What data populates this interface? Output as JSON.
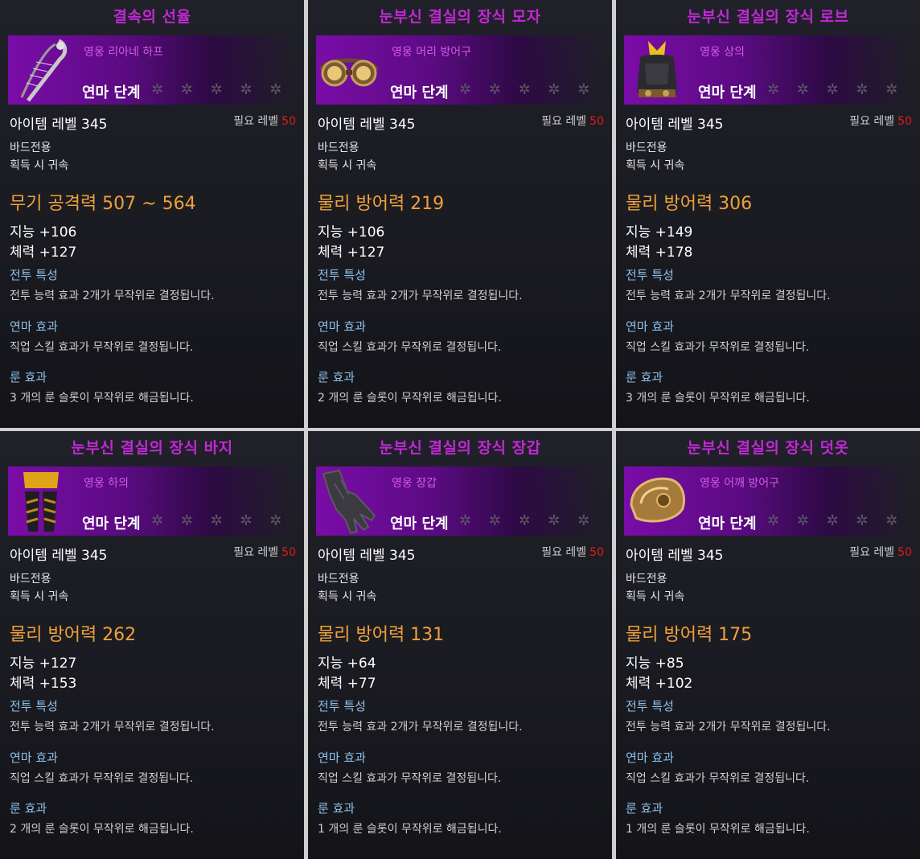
{
  "common": {
    "stage_label": "연마 단계",
    "stars": "✲ ✲ ✲ ✲ ✲",
    "item_level": "아이템 레벨 345",
    "req_label": "필요 레벨",
    "req_value": "50",
    "class_only": "바드전용",
    "bind": "획득 시 귀속",
    "combat_header": "전투 특성",
    "combat_desc": "전투 능력 효과 2개가 무작위로 결정됩니다.",
    "refine_header": "연마 효과",
    "refine_desc": "직업 스킬 효과가 무작위로 결정됩니다.",
    "rune_header": "룬 효과"
  },
  "colors": {
    "title": "#c327d6",
    "grade": "#d557e8",
    "main_stat": "#f0a03a",
    "section_header": "#8fc2ec",
    "required_level": "#e31a1a"
  },
  "cards": [
    {
      "title": "결속의 선율",
      "grade": "영웅 리아네 하프",
      "icon": "harp-icon",
      "main_stat": "무기 공격력 507 ~ 564",
      "stat1": "지능 +106",
      "stat2": "체력 +127",
      "rune_desc": "3 개의 룬 슬롯이 무작위로 해금됩니다."
    },
    {
      "title": "눈부신 결실의 장식 모자",
      "grade": "영웅 머리 방어구",
      "icon": "goggles-icon",
      "main_stat": "물리 방어력 219",
      "stat1": "지능 +106",
      "stat2": "체력 +127",
      "rune_desc": "2 개의 룬 슬롯이 무작위로 해금됩니다."
    },
    {
      "title": "눈부신 결실의 장식 로브",
      "grade": "영웅 상의",
      "icon": "robe-icon",
      "main_stat": "물리 방어력 306",
      "stat1": "지능 +149",
      "stat2": "체력 +178",
      "rune_desc": "3 개의 룬 슬롯이 무작위로 해금됩니다."
    },
    {
      "title": "눈부신 결실의 장식 바지",
      "grade": "영웅 하의",
      "icon": "pants-icon",
      "main_stat": "물리 방어력 262",
      "stat1": "지능 +127",
      "stat2": "체력 +153",
      "rune_desc": "2 개의 룬 슬롯이 무작위로 해금됩니다."
    },
    {
      "title": "눈부신 결실의 장식 장갑",
      "grade": "영웅 장갑",
      "icon": "glove-icon",
      "main_stat": "물리 방어력 131",
      "stat1": "지능 +64",
      "stat2": "체력 +77",
      "rune_desc": "1 개의 룬 슬롯이 무작위로 해금됩니다."
    },
    {
      "title": "눈부신 결실의 장식 덧옷",
      "grade": "영웅 어깨 방어구",
      "icon": "shoulder-armor-icon",
      "main_stat": "물리 방어력 175",
      "stat1": "지능 +85",
      "stat2": "체력 +102",
      "rune_desc": "1 개의 룬 슬롯이 무작위로 해금됩니다."
    }
  ]
}
